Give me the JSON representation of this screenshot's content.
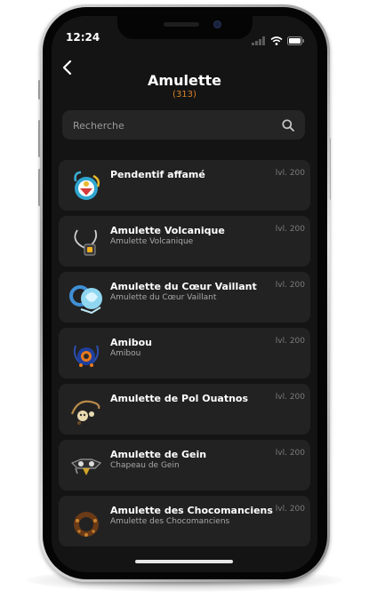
{
  "status_bar": {
    "time": "12:24"
  },
  "header": {
    "title": "Amulette",
    "count": "(313)"
  },
  "search": {
    "placeholder": "Recherche"
  },
  "items": [
    {
      "name": "Pendentif affamé",
      "subtitle": "",
      "level": "lvl. 200",
      "icon": "hungry-pendant-icon"
    },
    {
      "name": "Amulette Volcanique",
      "subtitle": "Amulette Volcanique",
      "level": "lvl. 200",
      "icon": "volcanic-amulet-icon"
    },
    {
      "name": "Amulette du Cœur Vaillant",
      "subtitle": "Amulette du Cœur Vaillant",
      "level": "lvl. 200",
      "icon": "valiant-heart-amulet-icon"
    },
    {
      "name": "Amibou",
      "subtitle": "Amibou",
      "level": "lvl. 200",
      "icon": "amibou-icon"
    },
    {
      "name": "Amulette de Pol Ouatnos",
      "subtitle": "",
      "level": "lvl. 200",
      "icon": "pol-ouatnos-amulet-icon"
    },
    {
      "name": "Amulette de Gein",
      "subtitle": "Chapeau de Gein",
      "level": "lvl. 200",
      "icon": "gein-amulet-icon"
    },
    {
      "name": "Amulette des Chocomanciens",
      "subtitle": "Amulette des Chocomanciens",
      "level": "lvl. 200",
      "icon": "chocomancer-amulet-icon"
    }
  ],
  "colors": {
    "background": "#141414",
    "card": "#222222",
    "accent": "#d9822b"
  }
}
